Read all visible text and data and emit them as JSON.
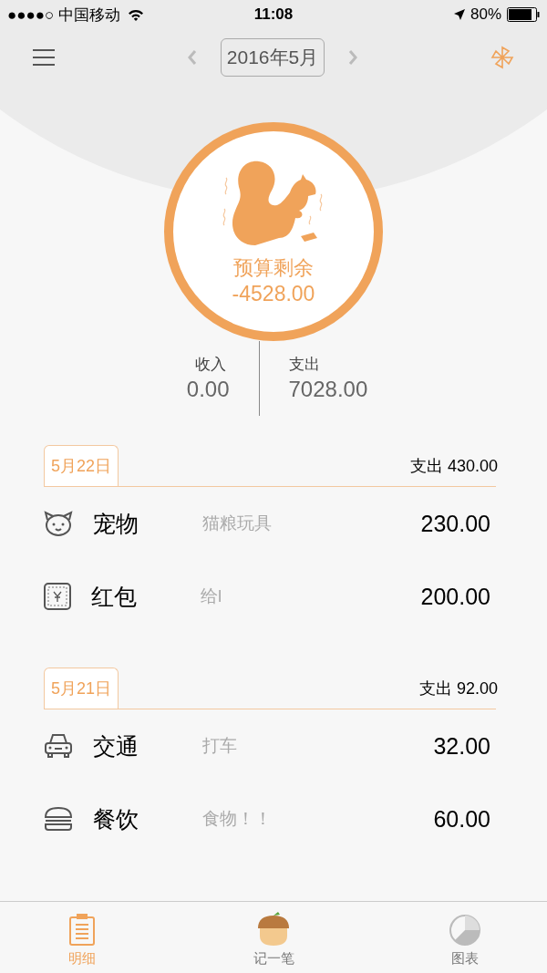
{
  "status_bar": {
    "carrier": "●●●●○ 中国移动",
    "time": "11:08",
    "battery": "80%"
  },
  "nav": {
    "month": "2016年5月"
  },
  "budget": {
    "label": "预算剩余",
    "value": "-4528.00"
  },
  "totals": [
    {
      "label": "收入",
      "value": "0.00"
    },
    {
      "label": "支出",
      "value": "7028.00"
    }
  ],
  "groups": [
    {
      "date": "5月22日",
      "summary": "支出 430.00",
      "entries": [
        {
          "kind": "pet",
          "category": "宠物",
          "note": "猫粮玩具",
          "amount": "230.00"
        },
        {
          "kind": "wallet",
          "category": "红包",
          "note": "给l",
          "amount": "200.00"
        }
      ]
    },
    {
      "date": "5月21日",
      "summary": "支出 92.00",
      "entries": [
        {
          "kind": "car",
          "category": "交通",
          "note": "打车",
          "amount": "32.00"
        },
        {
          "kind": "burger",
          "category": "餐饮",
          "note": "食物！！",
          "amount": "60.00"
        }
      ]
    }
  ],
  "tabs": [
    {
      "kind": "list",
      "label": "明细",
      "selected": true
    },
    {
      "kind": "acorn",
      "label": "记一笔",
      "selected": false
    },
    {
      "kind": "chart",
      "label": "图表",
      "selected": false
    }
  ]
}
